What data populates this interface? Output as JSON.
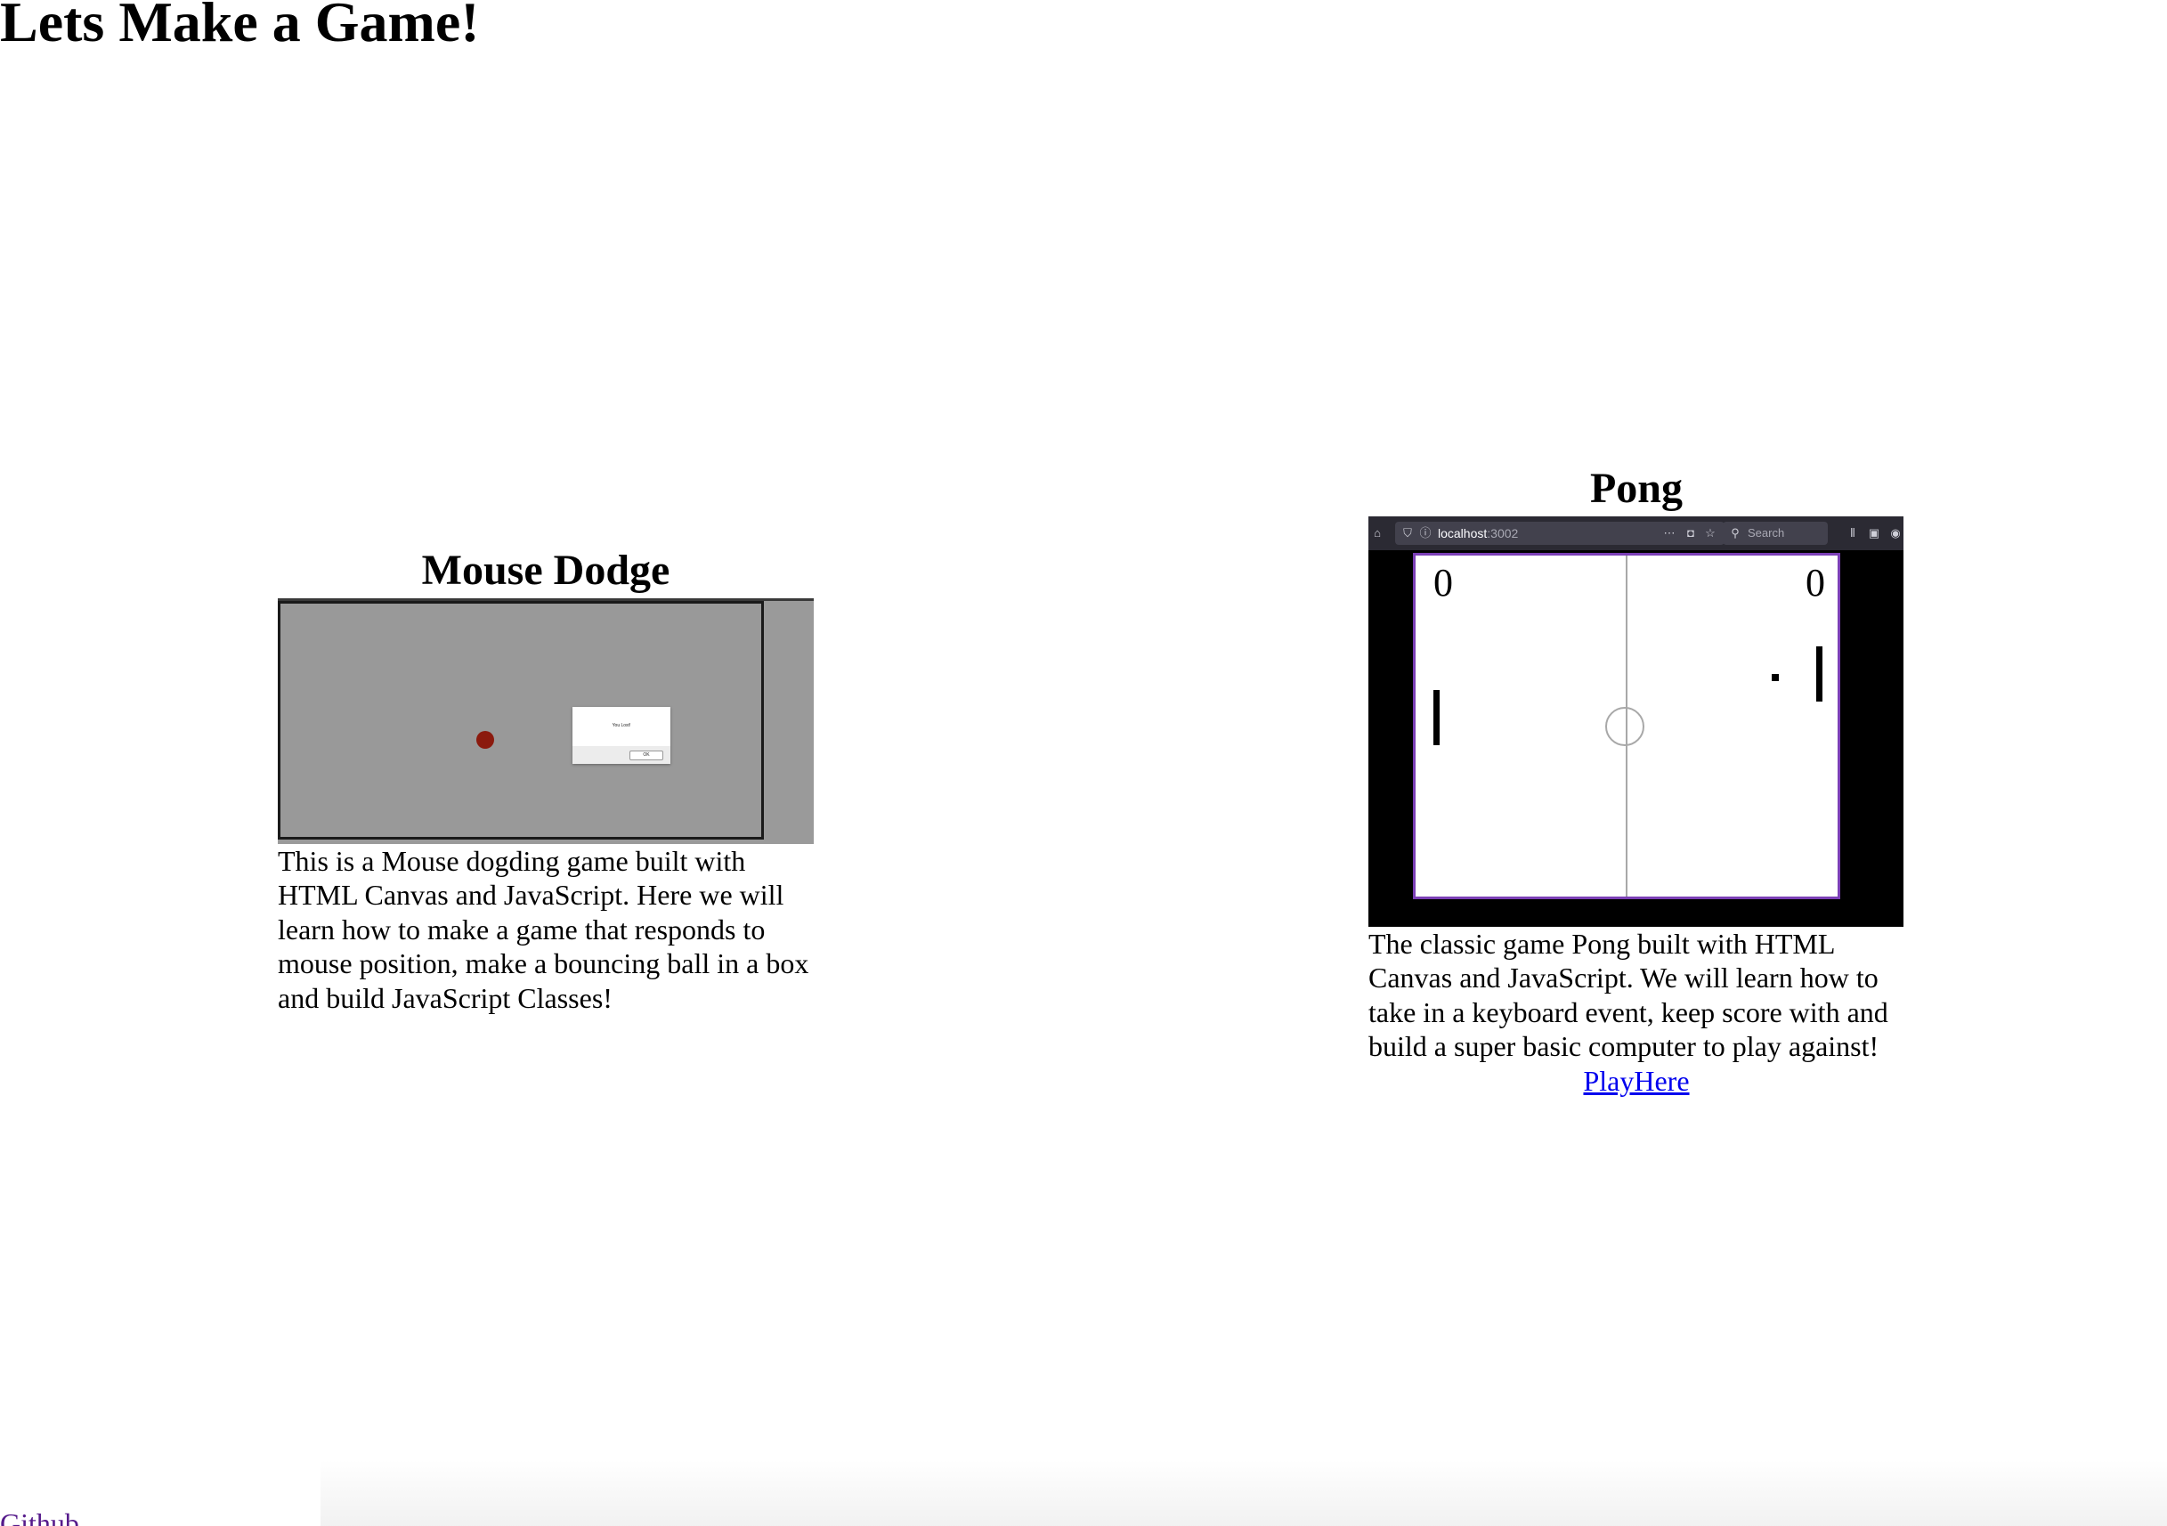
{
  "page": {
    "title": "Lets Make a Game!"
  },
  "games": {
    "mouse_dodge": {
      "title": "Mouse Dodge",
      "screenshot_colors": {
        "background": "#9a9a9a",
        "ball": "#8b1a0e"
      },
      "alert_message": "You Lost!",
      "alert_button": "OK",
      "description": "This is a Mouse dogding game built with HTML Canvas and JavaScript. Here we will learn how to make a game that responds to mouse position, make a bouncing ball in a box and build JavaScript Classes!"
    },
    "pong": {
      "title": "Pong",
      "browser": {
        "url_host": "localhost",
        "url_port": ":3002",
        "search_placeholder": "Search"
      },
      "score_left": "0",
      "score_right": "0",
      "screenshot_colors": {
        "field_border": "#7b3fb6",
        "toolbar": "#2b2a33"
      },
      "description": "The classic game Pong built with HTML Canvas and JavaScript. We will learn how to take in a keyboard event, keep score with and build a super basic computer to play against!",
      "link_label": "PlayHere"
    }
  },
  "footer": {
    "github_label": "Github"
  },
  "colors": {
    "link": "#0000ee",
    "visited_link": "#551a8b"
  }
}
